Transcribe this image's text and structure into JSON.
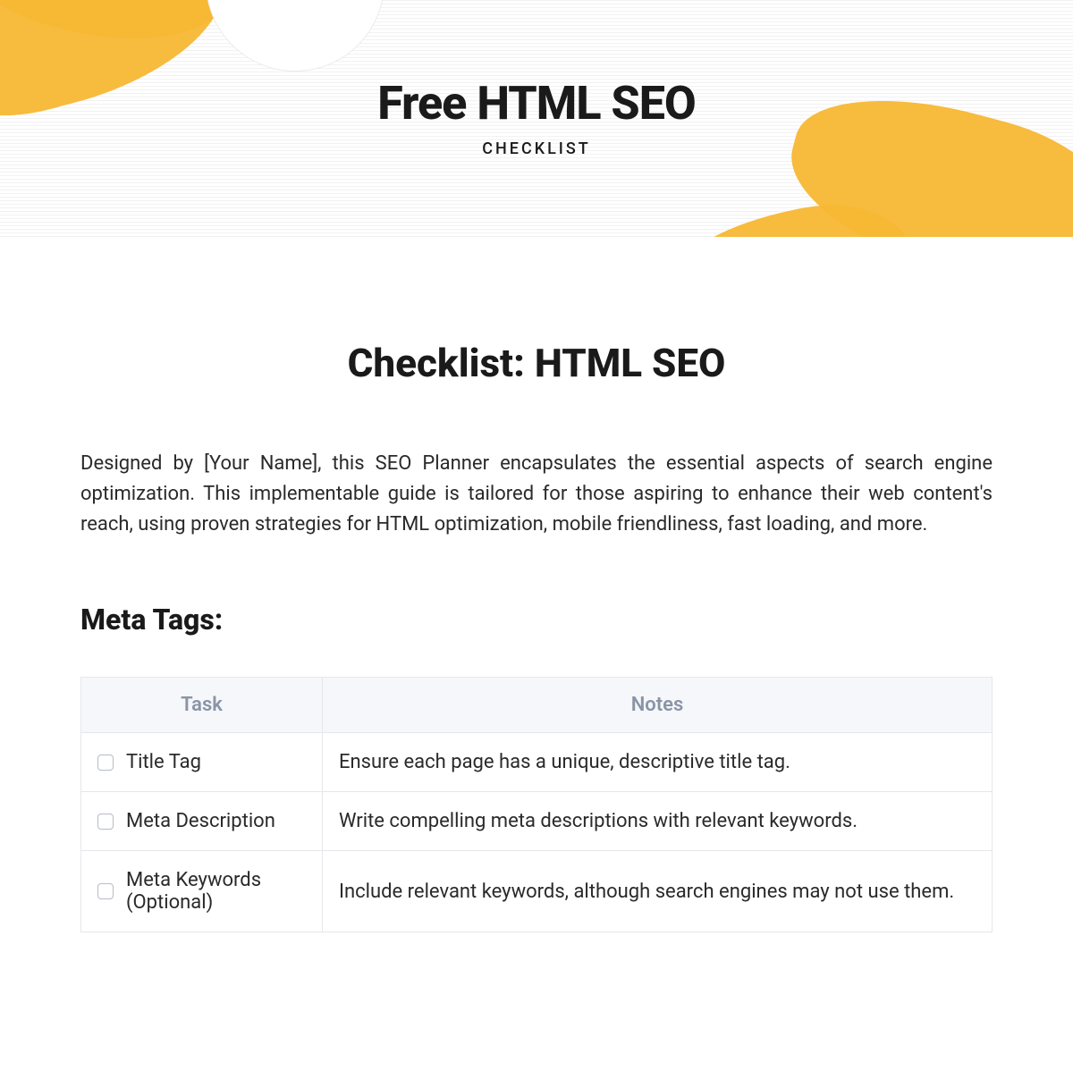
{
  "hero": {
    "title": "Free HTML SEO",
    "subtitle": "CHECKLIST"
  },
  "document": {
    "title": "Checklist: HTML SEO",
    "intro": "Designed by [Your Name], this SEO Planner encapsulates the essential aspects of search engine optimization. This implementable guide is tailored for those aspiring to enhance their web content's reach, using proven strategies for HTML optimization, mobile friendliness, fast loading, and more."
  },
  "section": {
    "heading": "Meta Tags:",
    "columns": {
      "task": "Task",
      "notes": "Notes"
    },
    "rows": [
      {
        "task": "Title Tag",
        "notes": "Ensure each page has a unique, descriptive title tag."
      },
      {
        "task": "Meta Description",
        "notes": "Write compelling meta descriptions with relevant keywords."
      },
      {
        "task": "Meta Keywords (Optional)",
        "notes": "Include relevant keywords, although search engines may not use them."
      }
    ]
  }
}
